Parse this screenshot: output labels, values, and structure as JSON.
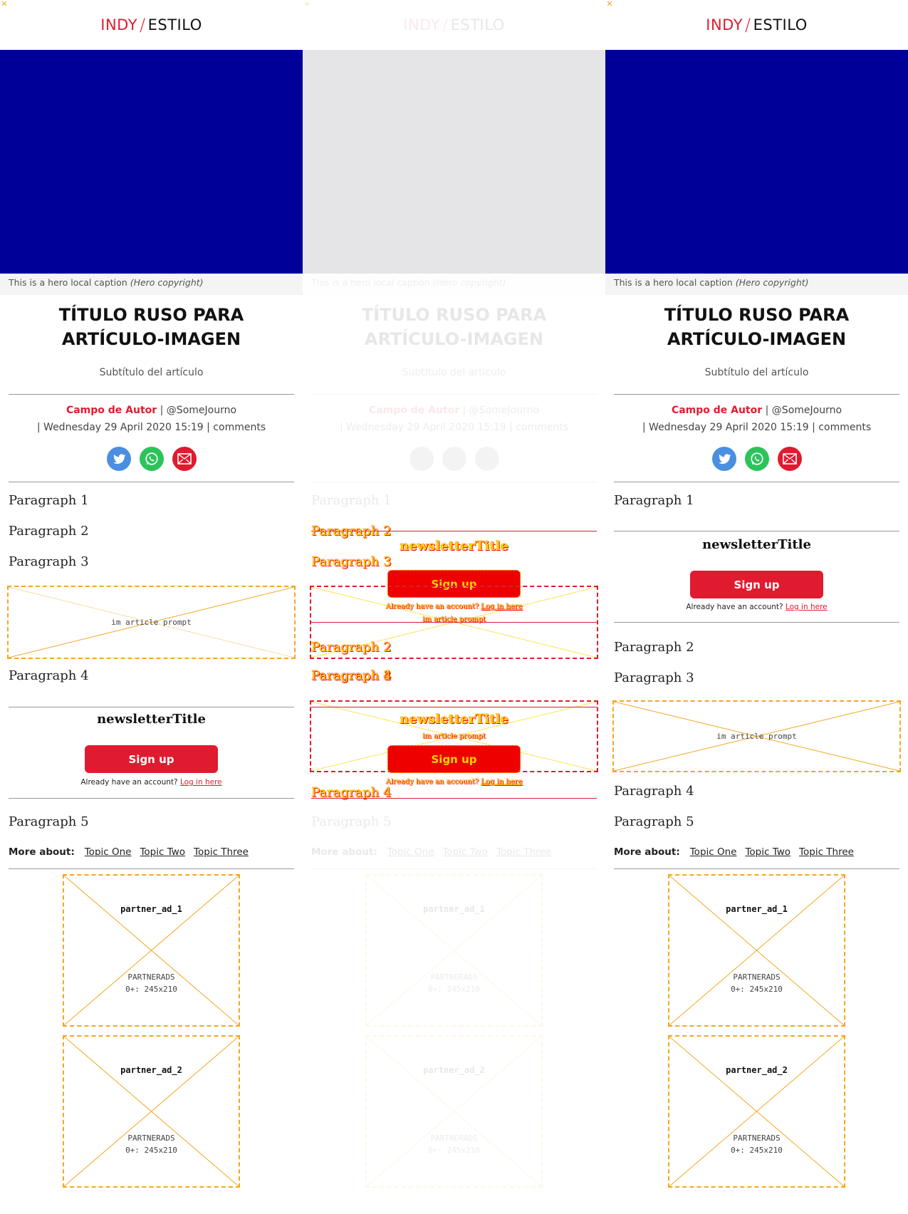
{
  "brand": {
    "left": "INDY",
    "slash": "/",
    "right": "ESTILO"
  },
  "corner_mark": "✕",
  "hero": {
    "caption": "This is a hero local caption",
    "copyright": "(Hero copyright)"
  },
  "article": {
    "title": "TÍTULO RUSO PARA ARTÍCULO-IMAGEN",
    "subtitle": "Subtítulo del artículo",
    "author": "Campo de Autor",
    "handle": "| @SomeJourno",
    "date_line": "| Wednesday 29 April 2020 15:19 |  comments"
  },
  "social": [
    "twitter-icon",
    "whatsapp-icon",
    "email-icon"
  ],
  "paragraphs": {
    "p1": "Paragraph 1",
    "p2": "Paragraph 2",
    "p3": "Paragraph 3",
    "p4": "Paragraph 4",
    "p5": "Paragraph 5"
  },
  "in_article_prompt": "im article prompt",
  "newsletter": {
    "title": "newsletterTitle",
    "signup": "Sign up",
    "login_prefix": "Already have an account?",
    "login_link": "Log in here"
  },
  "more_about": {
    "label": "More about:",
    "topics": [
      "Topic One",
      "Topic Two",
      "Topic Three"
    ]
  },
  "ads": [
    {
      "id": "partner_ad_1",
      "group": "PARTNERADS",
      "size": "0+: 245x210"
    },
    {
      "id": "partner_ad_2",
      "group": "PARTNERADS",
      "size": "0+: 245x210"
    }
  ],
  "colors": {
    "accent": "#e01b2f",
    "hero_blue": "#000099",
    "ad_outline": "#f5a623"
  }
}
